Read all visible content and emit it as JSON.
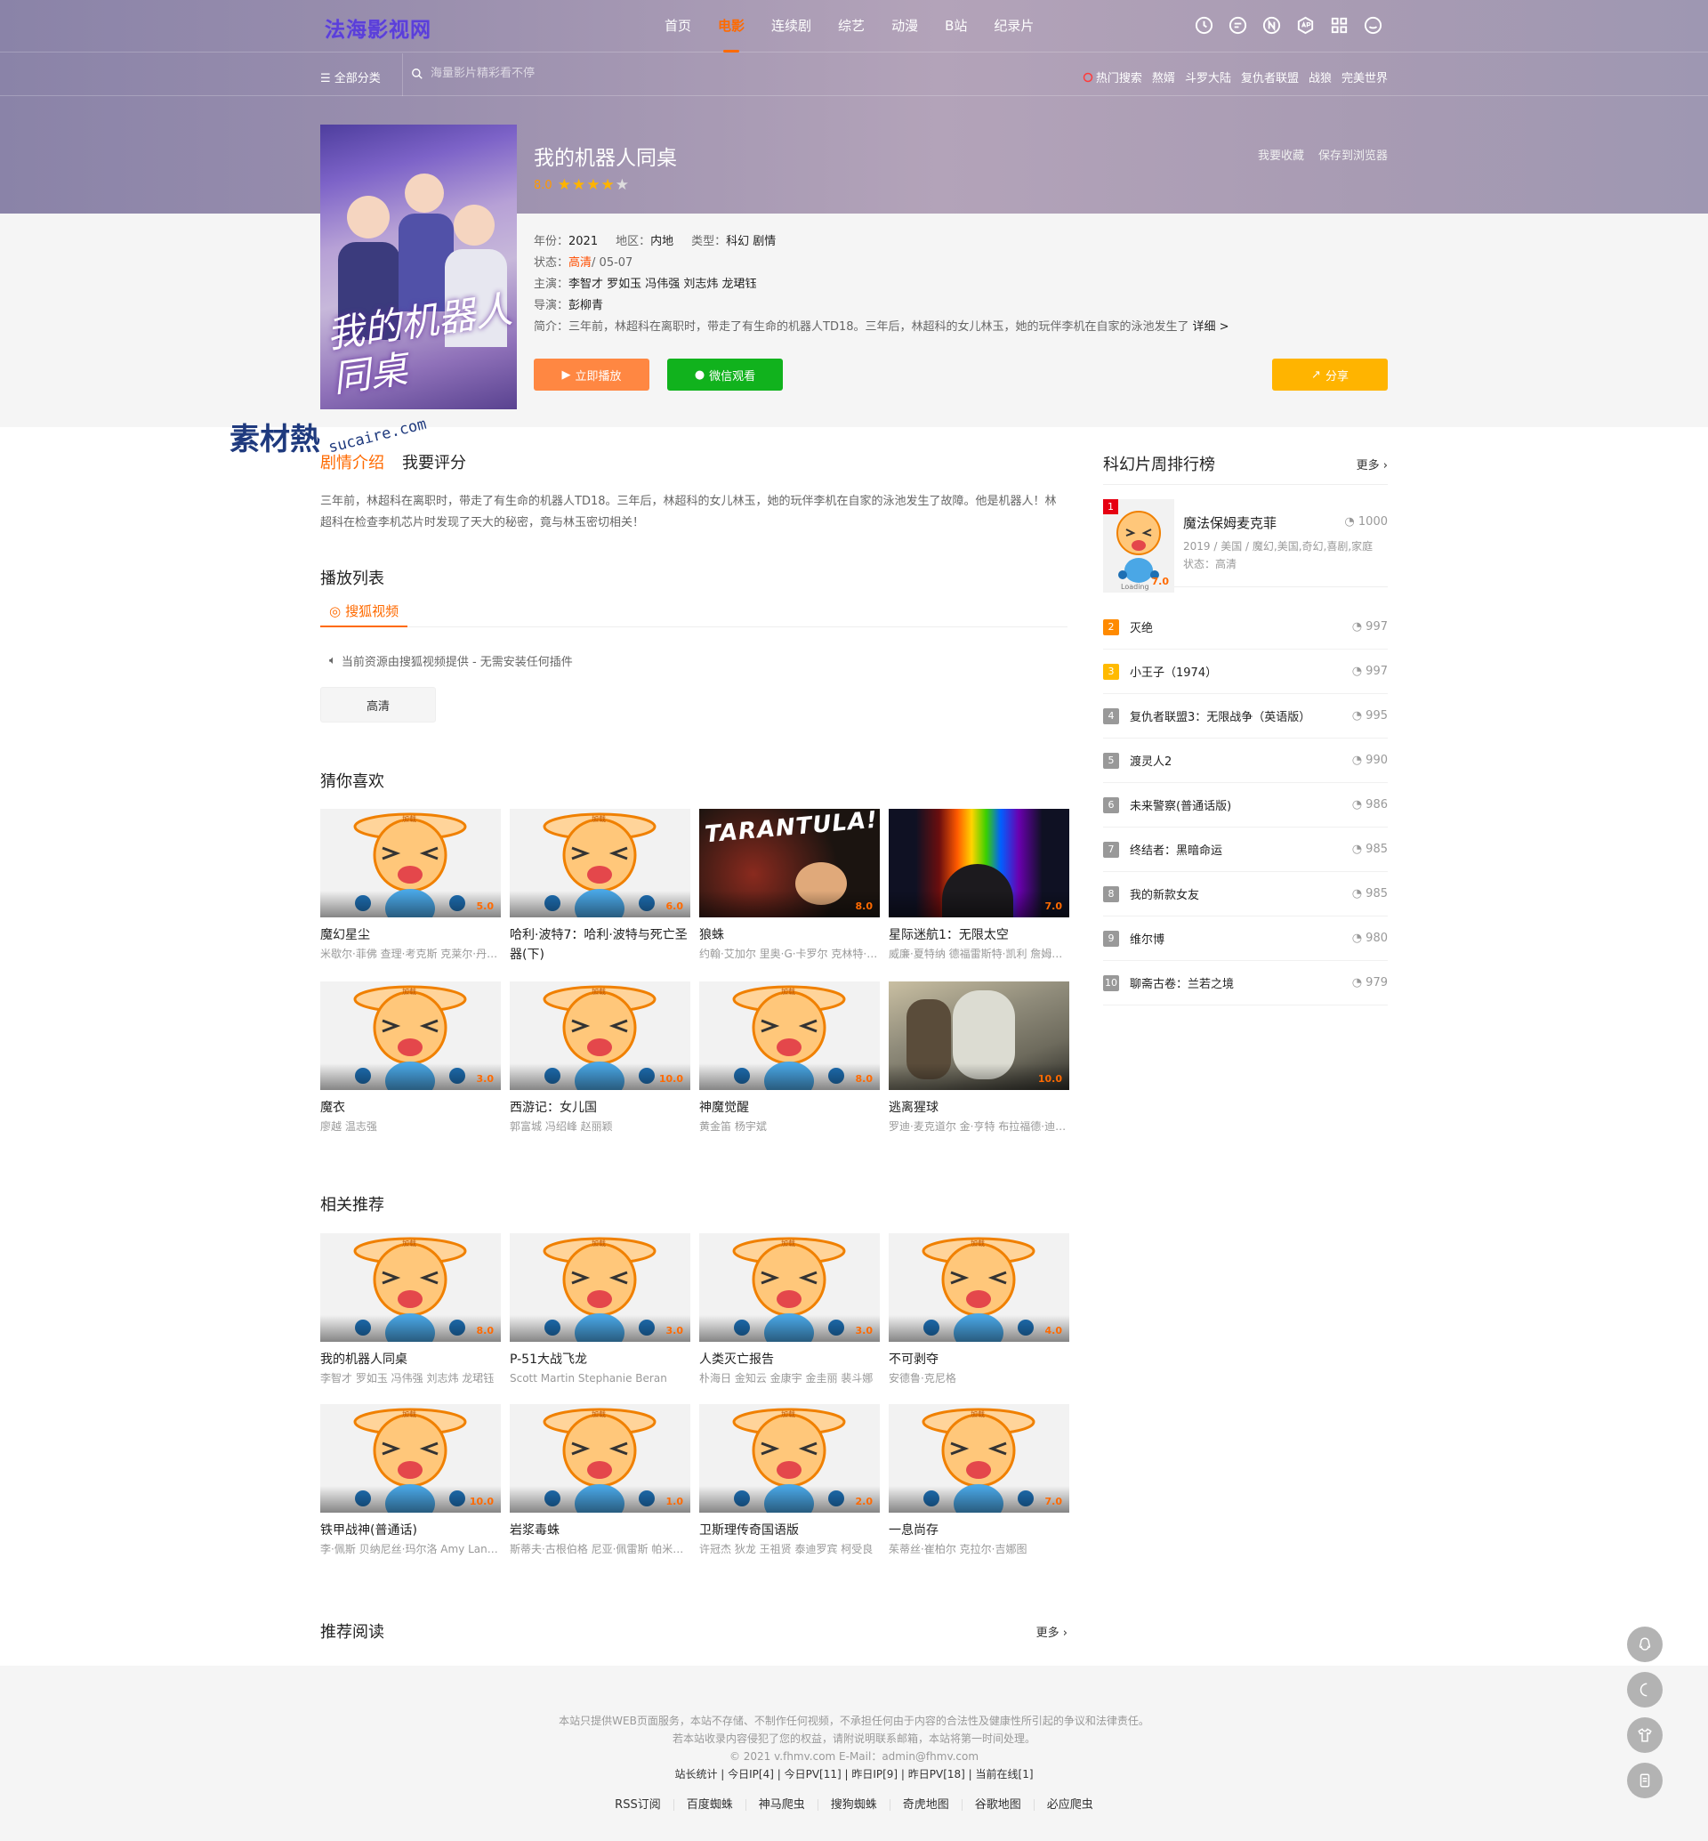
{
  "site": {
    "logo": "法海影视网"
  },
  "nav": {
    "items": [
      "首页",
      "电影",
      "连续剧",
      "综艺",
      "动漫",
      "B站",
      "纪录片"
    ],
    "active": "电影",
    "icons": [
      "clock-icon",
      "message-icon",
      "n-circle-icon",
      "app-icon",
      "grid-icon",
      "smile-icon"
    ]
  },
  "subnav": {
    "all_categories": "全部分类",
    "search_placeholder": "海量影片精彩看不停",
    "hot_label": "热门搜索",
    "hot_items": [
      "熬婿",
      "斗罗大陆",
      "复仇者联盟",
      "战狼",
      "完美世界"
    ]
  },
  "movie": {
    "title": "我的机器人同桌",
    "score": "8.0",
    "stars": 4,
    "favorite": "我要收藏",
    "save_browser": "保存到浏览器",
    "year_label": "年份：",
    "year": "2021",
    "region_label": "地区：",
    "region": "内地",
    "type_label": "类型：",
    "type": "科幻 剧情",
    "status_label": "状态：",
    "status_hd": "高清",
    "status_date": " / 05-07",
    "cast_label": "主演：",
    "cast": "李智才 罗如玉 冯伟强 刘志炜 龙珺钰",
    "director_label": "导演：",
    "director": "彭柳青",
    "summary_label": "简介：",
    "summary": "三年前，林超科在离职时，带走了有生命的机器人TD18。三年后，林超科的女儿林玉，她的玩伴李机在自家的泳池发生了",
    "more_detail": "详细 >",
    "play_button": "立即播放",
    "wechat_button": "微信观看",
    "share_button": "分享",
    "poster_text": "我的机器人同桌"
  },
  "watermark": {
    "mark": "素材熱",
    "domain": "sucaire.com"
  },
  "content": {
    "tab_intro": "剧情介绍",
    "tab_rate": "我要评分",
    "description": "三年前，林超科在离职时，带走了有生命的机器人TD18。三年后，林超科的女儿林玉，她的玩伴李机在自家的泳池发生了故障。他是机器人！林超科在检查李机芯片时发现了天大的秘密，竟与林玉密切相关！",
    "playlist_title": "播放列表",
    "source_tab": "搜狐视频",
    "source_notice": "当前资源由搜狐视频提供 - 无需安装任何插件",
    "episode": "高清",
    "guess_title": "猜你喜欢",
    "related_title": "相关推荐",
    "read_title": "推荐阅读",
    "read_more": "更多"
  },
  "guess": [
    {
      "name": "魔幻星尘",
      "actors": "米歇尔·菲佛 查理·考克斯 克莱尔·丹尼斯",
      "score": "5.0",
      "img": "loading"
    },
    {
      "name": "哈利·波特7：哈利·波特与死亡圣器(下)",
      "actors": "",
      "score": "6.0",
      "img": "loading"
    },
    {
      "name": "狼蛛",
      "actors": "约翰·艾加尔 里奥·G·卡罗尔 克林特·伊斯特伍德",
      "score": "8.0",
      "img": "tarantula",
      "poster_title": "TARANTULA!"
    },
    {
      "name": "星际迷航1：无限太空",
      "actors": "威廉·夏特纳 德福雷斯特·凯利 詹姆斯·杜汉",
      "score": "7.0",
      "img": "rainbow"
    },
    {
      "name": "魔衣",
      "actors": "廖越 温志强",
      "score": "3.0",
      "img": "loading"
    },
    {
      "name": "西游记：女儿国",
      "actors": "郭富城 冯绍峰 赵丽颖",
      "score": "10.0",
      "img": "loading"
    },
    {
      "name": "神魔觉醒",
      "actors": "黄金笛 杨宇斌",
      "score": "8.0",
      "img": "loading"
    },
    {
      "name": "逃离猩球",
      "actors": "罗迪·麦克道尔 金·亨特 布拉福德·迪尔曼",
      "score": "10.0",
      "img": "ape"
    }
  ],
  "related": [
    {
      "name": "我的机器人同桌",
      "actors": "李智才 罗如玉 冯伟强 刘志炜 龙珺钰",
      "score": "8.0"
    },
    {
      "name": "P-51大战飞龙",
      "actors": "Scott Martin Stephanie Beran",
      "score": "3.0"
    },
    {
      "name": "人类灭亡报告",
      "actors": "朴海日 金知云 金康宇 金圭丽 裴斗娜",
      "score": "3.0"
    },
    {
      "name": "不可剥夺",
      "actors": "安德鲁·克尼格",
      "score": "4.0"
    },
    {
      "name": "铁甲战神(普通话)",
      "actors": "李·佩斯 贝纳尼丝·玛尔洛 Amy Landecker",
      "score": "10.0"
    },
    {
      "name": "岩浆毒蛛",
      "actors": "斯蒂夫·古根伯格 尼亚·佩雷斯 帕米拉·戴维斯",
      "score": "1.0"
    },
    {
      "name": "卫斯理传奇国语版",
      "actors": "许冠杰 狄龙 王祖贤 泰迪罗宾 柯受良",
      "score": "2.0"
    },
    {
      "name": "一息尚存",
      "actors": "茱蒂丝·崔柏尔 克拉尔·吉娜图",
      "score": "7.0"
    }
  ],
  "ranking": {
    "title": "科幻片周排行榜",
    "more": "更多",
    "top": {
      "rank": "1",
      "name": "魔法保姆麦克菲",
      "hits": "1000",
      "sub": "2019 / 美国 / 魔幻,美国,奇幻,喜剧,家庭",
      "status": "状态：高清",
      "score": "7.0"
    },
    "items": [
      {
        "rank": "2",
        "name": "灭绝",
        "hits": "997"
      },
      {
        "rank": "3",
        "name": "小王子（1974）",
        "hits": "997"
      },
      {
        "rank": "4",
        "name": "复仇者联盟3：无限战争（英语版）",
        "hits": "995"
      },
      {
        "rank": "5",
        "name": "渡灵人2",
        "hits": "990"
      },
      {
        "rank": "6",
        "name": "未来警察(普通话版)",
        "hits": "986"
      },
      {
        "rank": "7",
        "name": "终结者：黑暗命运",
        "hits": "985"
      },
      {
        "rank": "8",
        "name": "我的新款女友",
        "hits": "985"
      },
      {
        "rank": "9",
        "name": "维尔博",
        "hits": "980"
      },
      {
        "rank": "10",
        "name": "聊斋古卷：兰若之境",
        "hits": "979"
      }
    ]
  },
  "footer": {
    "line1": "本站只提供WEB页面服务，本站不存储、不制作任何视频，不承担任何由于内容的合法性及健康性所引起的争议和法律责任。",
    "line2": "若本站收录内容侵犯了您的权益，请附说明联系邮箱，本站将第一时间处理。",
    "line3": "© 2021 v.fhmv.com  E-Mail：admin@fhmv.com",
    "line4": "站长统计 | 今日IP[4] | 今日PV[11] | 昨日IP[9] | 昨日PV[18] | 当前在线[1]",
    "links": [
      "RSS订阅",
      "百度蜘蛛",
      "神马爬虫",
      "搜狗蜘蛛",
      "奇虎地图",
      "谷歌地图",
      "必应爬虫"
    ]
  },
  "float_buttons": [
    "qq-icon",
    "moon-icon",
    "shirt-icon",
    "note-icon"
  ],
  "colors": {
    "accent": "#ff6a00",
    "play": "#ff8742",
    "wechat": "#11b21d",
    "share": "#ffb400",
    "rank1": "#e60012"
  }
}
